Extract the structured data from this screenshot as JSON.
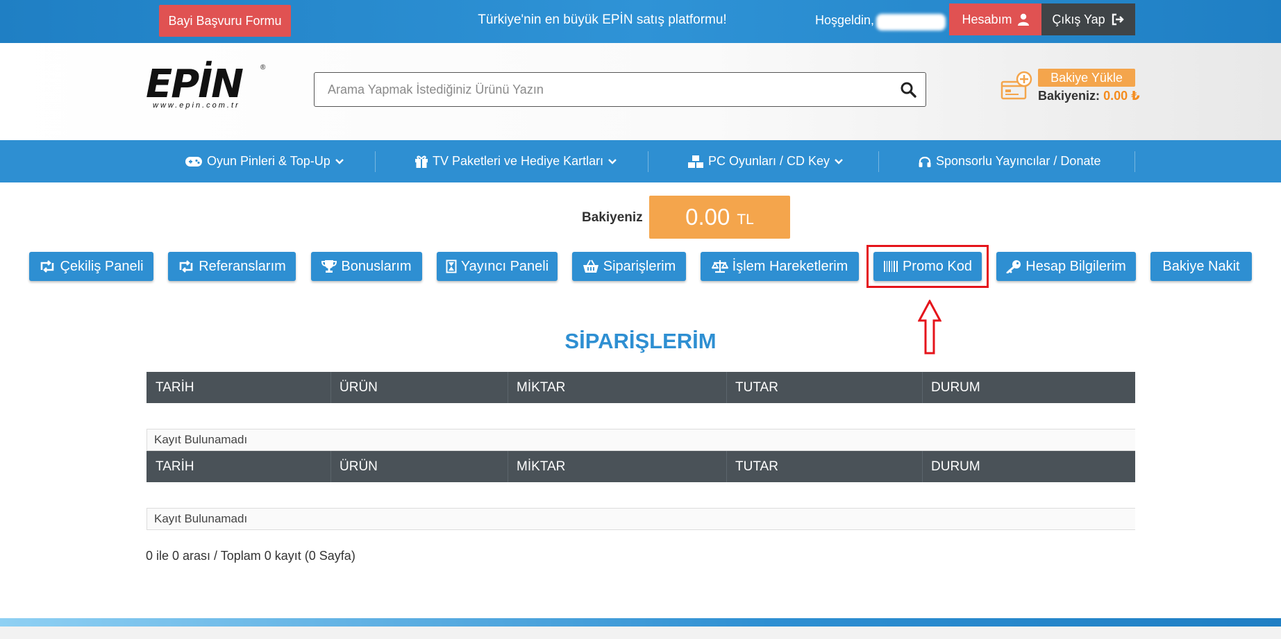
{
  "topbar": {
    "dealer_form_label": "Bayi Başvuru Formu",
    "tagline": "Türkiye'nin en büyük EPİN satış platformu!",
    "welcome": "Hoşgeldin,",
    "account_label": "Hesabım",
    "logout_label": "Çıkış Yap"
  },
  "header": {
    "logo_text": "EPİN",
    "logo_sub": "www.epin.com.tr",
    "logo_reg": "®",
    "search_placeholder": "Arama Yapmak İstediğiniz Ürünü Yazın",
    "load_balance_label": "Bakiye Yükle",
    "balance_label": "Bakiyeniz:",
    "balance_value": "0.00 ₺"
  },
  "nav": [
    {
      "label": "Oyun Pinleri & Top-Up",
      "icon": "gamepad-icon"
    },
    {
      "label": "TV Paketleri ve Hediye Kartları",
      "icon": "gift-icon"
    },
    {
      "label": "PC Oyunları / CD Key",
      "icon": "cubes-icon"
    },
    {
      "label": "Sponsorlu Yayıncılar / Donate",
      "icon": "headphones-icon"
    }
  ],
  "balance": {
    "label": "Bakiyeniz",
    "amount": "0.00",
    "currency": "TL"
  },
  "panel_buttons": [
    {
      "label": "Çekiliş Paneli",
      "icon": "retweet-icon"
    },
    {
      "label": "Referanslarım",
      "icon": "retweet-icon"
    },
    {
      "label": "Bonuslarım",
      "icon": "trophy-icon"
    },
    {
      "label": "Yayıncı Paneli",
      "icon": "hourglass-icon"
    },
    {
      "label": "Siparişlerim",
      "icon": "basket-icon"
    },
    {
      "label": "İşlem Hareketlerim",
      "icon": "balance-scale-icon"
    },
    {
      "label": "Promo Kod",
      "icon": "barcode-icon"
    },
    {
      "label": "Hesap Bilgilerim",
      "icon": "key-icon"
    },
    {
      "label": "Bakiye Nakit",
      "icon": ""
    }
  ],
  "section_title": "SİPARİŞLERİM",
  "table_headers": [
    "TARİH",
    "ÜRÜN",
    "MİKTAR",
    "TUTAR",
    "DURUM"
  ],
  "no_record_text": "Kayıt Bulunamadı",
  "pagination_text": "0 ile 0 arası / Toplam 0 kayıt (0 Sayfa)",
  "colors": {
    "primary_blue": "#2e8fd2",
    "red": "#e05252",
    "orange": "#f4a54c",
    "dark": "#4a5258",
    "highlight_red": "#e5141b"
  }
}
